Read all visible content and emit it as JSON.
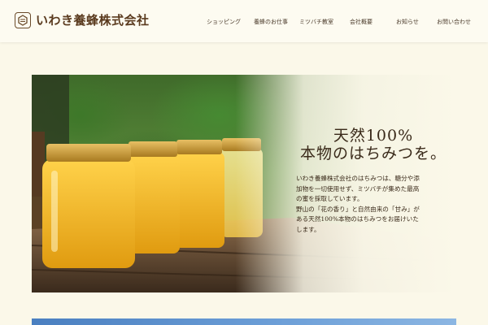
{
  "brand": {
    "name": "いわき養蜂株式会社"
  },
  "nav": {
    "items": [
      {
        "label": "ショッピング"
      },
      {
        "label": "養蜂のお仕事"
      },
      {
        "label": "ミツバチ教室"
      },
      {
        "label": "会社概要"
      },
      {
        "label": "お知らせ"
      },
      {
        "label": "お問い合わせ"
      }
    ]
  },
  "hero": {
    "title_line1": "天然100%",
    "title_line2": "本物のはちみつを。",
    "body_lines": [
      "いわき養蜂株式会社のはちみつは、糖分や添",
      "加物を一切使用せず、ミツバチが集めた最高",
      "の蜜を採取しています。",
      "野山の「花の香り」と自然由来の「甘み」が",
      "ある天然100%本物のはちみつをお届けいた",
      "します。"
    ],
    "image_icon": "honey-jars-photo"
  },
  "colors": {
    "background": "#fbf8e9",
    "brand": "#5a3a1e",
    "honey": "#f2b61d",
    "lid": "#c89a2e"
  }
}
